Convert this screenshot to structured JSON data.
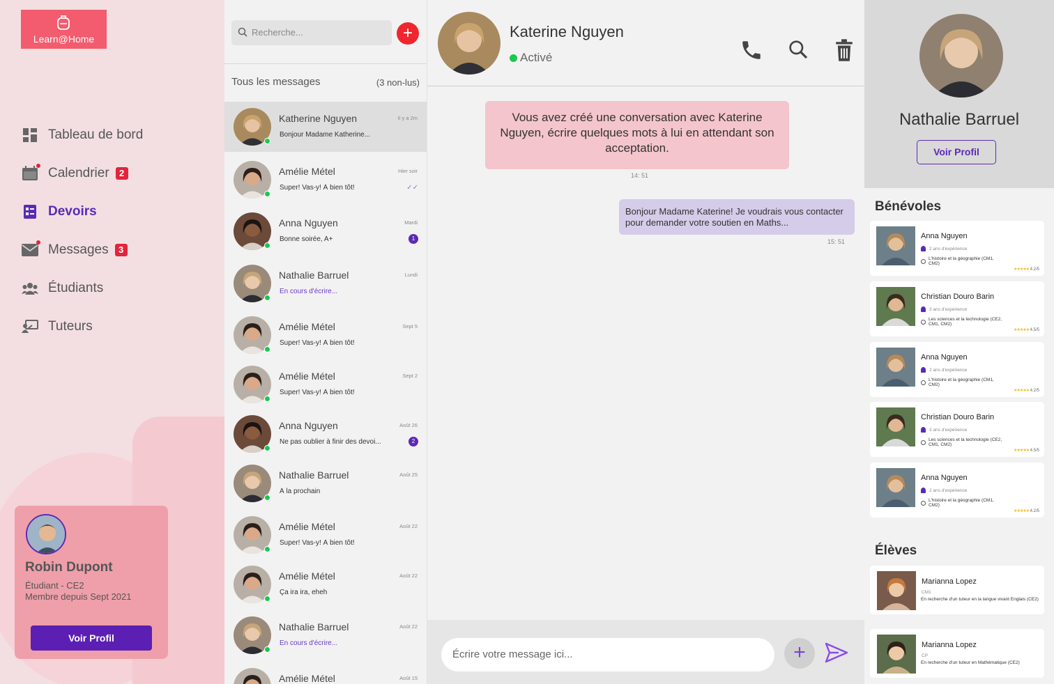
{
  "app": {
    "logo_text": "Learn@Home"
  },
  "nav": [
    {
      "label": "Tableau de bord",
      "badge": "",
      "icon": "dashboard-icon"
    },
    {
      "label": "Calendrier",
      "badge": "2",
      "icon": "calendar-icon"
    },
    {
      "label": "Devoirs",
      "badge": "",
      "icon": "homework-icon",
      "active": true
    },
    {
      "label": "Messages",
      "badge": "3",
      "icon": "mail-icon"
    },
    {
      "label": "Étudiants",
      "badge": "",
      "icon": "students-icon"
    },
    {
      "label": "Tuteurs",
      "badge": "",
      "icon": "tutors-icon"
    }
  ],
  "user": {
    "name": "Robin Dupont",
    "role": "Étudiant - CE2",
    "since": "Membre depuis Sept 2021",
    "button": "Voir Profil"
  },
  "search": {
    "placeholder": "Recherche..."
  },
  "list": {
    "title": "Tous les messages",
    "unread": "(3 non-lus)"
  },
  "conversations": [
    {
      "name": "Katherine Nguyen",
      "preview": "Bonjour Madame Katherine...",
      "time": "Il y a 2m"
    },
    {
      "name": "Amélie Métel",
      "preview": "Super! Vas-y! À bien tôt!",
      "time": "Hier soir"
    },
    {
      "name": "Anna Nguyen",
      "preview": "Bonne soirée, A+",
      "time": "Mardi",
      "badge": "1"
    },
    {
      "name": "Nathalie Barruel",
      "preview": "En cours d'écrire...",
      "time": "Lundi"
    },
    {
      "name": "Amélie Métel",
      "preview": "Super! Vas-y! À bien tôt!",
      "time": "Sept 5"
    },
    {
      "name": "Amélie Métel",
      "preview": "Super! Vas-y! À bien tôt!",
      "time": "Sept 2"
    },
    {
      "name": "Anna Nguyen",
      "preview": "Ne pas oublier à finir des devoi...",
      "time": "Août 26",
      "badge": "2"
    },
    {
      "name": "Nathalie Barruel",
      "preview": "À la prochain",
      "time": "Août 25"
    },
    {
      "name": "Amélie Métel",
      "preview": "Super! Vas-y! À bien tôt!",
      "time": "Août 22"
    },
    {
      "name": "Amélie Métel",
      "preview": "Ça ira ira, eheh",
      "time": "Août 22"
    },
    {
      "name": "Nathalie Barruel",
      "preview": "En cours d'écrire...",
      "time": "Août 22"
    },
    {
      "name": "Amélie Métel",
      "preview": "",
      "time": "Août 15"
    }
  ],
  "chat": {
    "contact": "Katerine Nguyen",
    "status": "Activé",
    "system_message": "Vous avez créé une conversation avec Katerine Nguyen, écrire quelques mots à lui en attendant son acceptation.",
    "system_time": "14: 51",
    "outgoing_message": "Bonjour Madame Katerine! Je voudrais vous contacter pour demander votre soutien en Maths...",
    "outgoing_time": "15: 51",
    "input_placeholder": "Écrire votre message ici..."
  },
  "panel": {
    "name": "Nathalie Barruel",
    "button": "Voir Profil",
    "volunteers_title": "Bénévoles",
    "volunteers": [
      {
        "name": "Anna Nguyen",
        "exp": "2 ans d'expérience",
        "subject": "L'histoire et la géographie (CM1, CM2)",
        "rating": "4.2/5"
      },
      {
        "name": "Christian Douro Barin",
        "exp": "3 ans d'expérience",
        "subject": "Les sciences et la technologie (CE2, CM1, CM2)",
        "rating": "4.5/5"
      },
      {
        "name": "Anna Nguyen",
        "exp": "2 ans d'expérience",
        "subject": "L'histoire et la géographie (CM1, CM2)",
        "rating": "4.2/5"
      },
      {
        "name": "Christian Douro Barin",
        "exp": "3 ans d'expérience",
        "subject": "Les sciences et la technologie (CE2, CM1, CM2)",
        "rating": "4.5/5"
      },
      {
        "name": "Anna Nguyen",
        "exp": "2 ans d'expérience",
        "subject": "L'histoire et la géographie (CM1, CM2)",
        "rating": "4.2/5"
      }
    ],
    "students_title": "Élèves",
    "students": [
      {
        "name": "Marianna Lopez",
        "grade": "CM1",
        "desc": "En recherche d'un tuteur en la langue vivant Englais (CE2)"
      },
      {
        "name": "Marianna Lopez",
        "grade": "CP",
        "desc": "En recherche d'un tuteur en Mathématique (CE2)"
      }
    ]
  },
  "colors": {
    "accent": "#5b2ab5",
    "brand": "#f25c6e",
    "online": "#17c94d",
    "alert": "#e1253a"
  }
}
